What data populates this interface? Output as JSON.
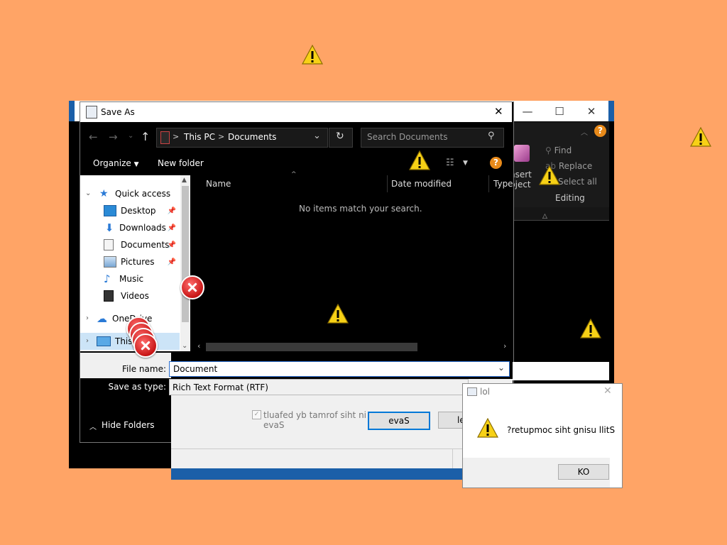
{
  "background": "#FFA466",
  "colors": {
    "accent_blue": "#1B5FA8",
    "warning_yellow": "#F7D116",
    "error_red": "#C81616"
  },
  "bg_window": {
    "minimize": "—",
    "maximize": "☐",
    "close": "✕",
    "help_icon": "?",
    "ribbon": {
      "find": "Find",
      "replace": "Replace",
      "select_all": "Select all",
      "insert_line1": "nsert",
      "insert_line2": "bject",
      "group": "Editing"
    }
  },
  "dialog": {
    "title": "Save As",
    "close": "✕",
    "breadcrumb": {
      "root": "This PC",
      "sep": ">",
      "folder": "Documents"
    },
    "search_placeholder": "Search Documents",
    "toolbar": {
      "organize": "Organize",
      "new_folder": "New folder"
    },
    "nav": {
      "quick_access": "Quick access",
      "items": [
        {
          "label": "Desktop"
        },
        {
          "label": "Downloads"
        },
        {
          "label": "Documents"
        },
        {
          "label": "Pictures"
        },
        {
          "label": "Music"
        },
        {
          "label": "Videos"
        }
      ],
      "onedrive": "OneDrive",
      "this_pc": "This PC"
    },
    "columns": {
      "name": "Name",
      "date_modified": "Date modified",
      "type": "Type"
    },
    "empty_message": "No items match your search.",
    "file_name_label": "File name:",
    "file_name_value": "Document",
    "save_type_label": "Save as type:",
    "save_type_value": "Rich Text Format (RTF)",
    "checkbox_label_1": "tluafed yb tamrof siht ni",
    "checkbox_label_2": "evaS",
    "save_button": "evaS",
    "cancel_button": "le",
    "hide_folders": "Hide Folders"
  },
  "message_box": {
    "title": "lol",
    "text": "?retupmoc siht gnisu llitS",
    "ok": "KO"
  }
}
